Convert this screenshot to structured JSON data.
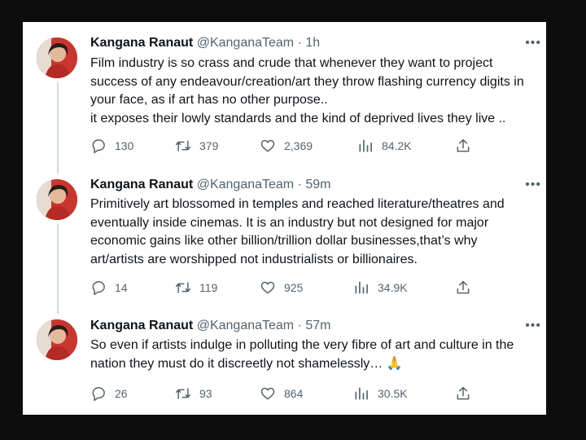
{
  "tweets": [
    {
      "name": "Kangana Ranaut",
      "handle": "@KanganaTeam",
      "separator": "·",
      "time": "1h",
      "more": "•••",
      "text": "Film industry is so crass and crude that whenever they want to project\nsuccess of any endeavour/creation/art they throw flashing currency digits in\nyour face, as if art has no other purpose..\nit exposes their lowly standards and the kind of deprived lives they live ..",
      "replies": "130",
      "retweets": "379",
      "likes": "2,369",
      "views": "84.2K"
    },
    {
      "name": "Kangana Ranaut",
      "handle": "@KanganaTeam",
      "separator": "·",
      "time": "59m",
      "more": "•••",
      "text": "Primitively art blossomed in temples and reached literature/theatres and\neventually inside cinemas. It is an industry but not designed for major\neconomic gains like other billion/trillion dollar businesses,that’s why\nart/artists are worshipped not industrialists or billionaires.",
      "replies": "14",
      "retweets": "119",
      "likes": "925",
      "views": "34.9K"
    },
    {
      "name": "Kangana Ranaut",
      "handle": "@KanganaTeam",
      "separator": "·",
      "time": "57m",
      "more": "•••",
      "text": "So even if artists indulge in polluting the very fibre of art and culture in the\nnation they must do it discreetly not shamelessly… 🙏",
      "replies": "26",
      "retweets": "93",
      "likes": "864",
      "views": "30.5K"
    }
  ],
  "icons": {
    "reply": "reply-icon",
    "retweet": "retweet-icon",
    "like": "heart-icon",
    "views": "views-icon",
    "share": "share-icon"
  },
  "colors": {
    "text": "#0f1419",
    "secondary": "#536471",
    "thread_line": "#cfd9de",
    "avatar_red": "#c9362f"
  }
}
